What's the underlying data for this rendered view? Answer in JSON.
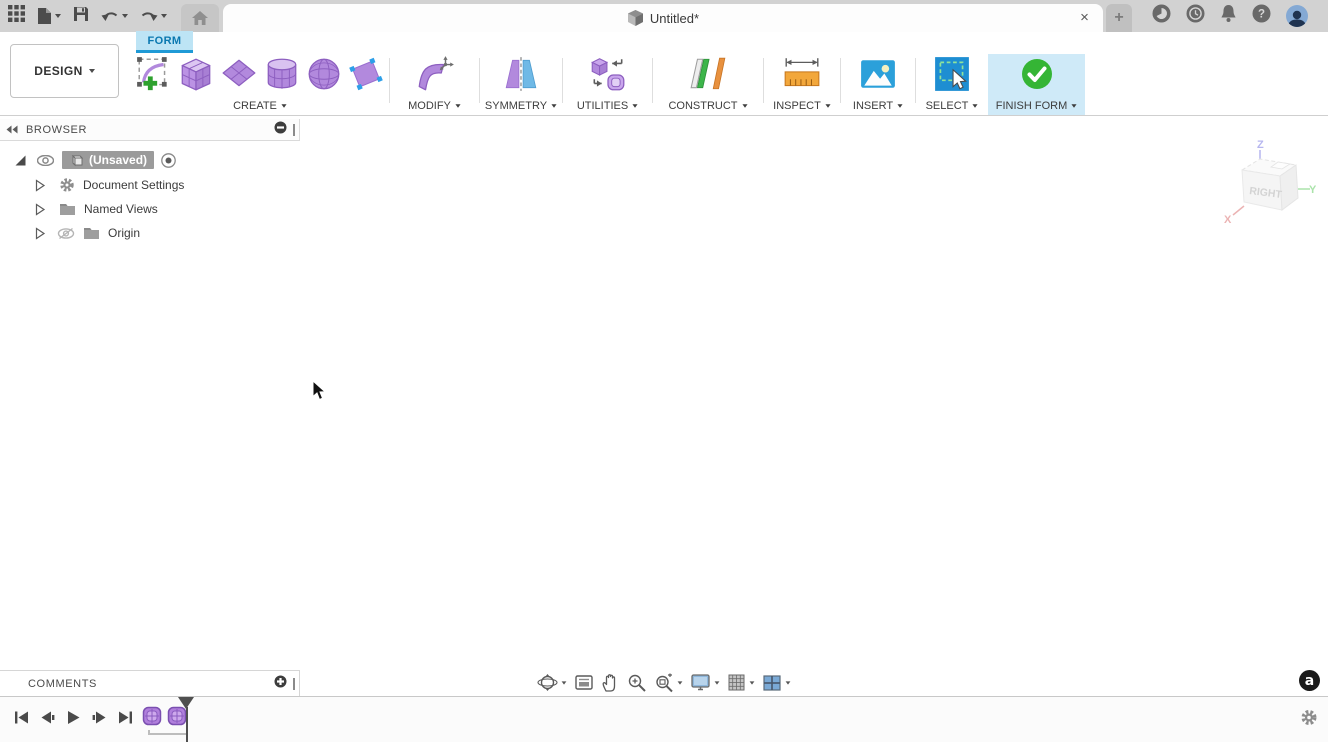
{
  "titlebar": {
    "left_icons": [
      "app-grid",
      "file",
      "save",
      "undo",
      "redo"
    ],
    "home_tab_icon": "home",
    "document_tab": {
      "title": "Untitled*",
      "close_glyph": "×",
      "icon": "model-cube"
    },
    "new_tab_glyph": "+",
    "right_icons": [
      "extensions",
      "job-status-clock",
      "notifications-bell",
      "help",
      "profile-avatar"
    ],
    "help_glyph": "?"
  },
  "toolbar": {
    "workspace": {
      "label": "DESIGN"
    },
    "context_tab": {
      "label": "FORM"
    },
    "sections": [
      {
        "label": "CREATE",
        "icons": [
          "create-form",
          "box-primitive",
          "plane-primitive",
          "cylinder-primitive",
          "sphere-primitive",
          "face-primitive"
        ]
      },
      {
        "label": "MODIFY",
        "icons": [
          "edit-form"
        ]
      },
      {
        "label": "SYMMETRY",
        "icons": [
          "mirror-symmetry"
        ]
      },
      {
        "label": "UTILITIES",
        "icons": [
          "convert-utility"
        ]
      },
      {
        "label": "CONSTRUCT",
        "icons": [
          "construction-plane"
        ]
      },
      {
        "label": "INSPECT",
        "icons": [
          "measure"
        ]
      },
      {
        "label": "INSERT",
        "icons": [
          "insert-image"
        ]
      },
      {
        "label": "SELECT",
        "icons": [
          "select-window"
        ]
      },
      {
        "label": "FINISH FORM",
        "icons": [
          "finish-form-check"
        ],
        "highlighted": true
      }
    ]
  },
  "browser": {
    "title": "BROWSER",
    "header_icons": [
      "collapse-panel",
      "display-mode",
      "resize-handle"
    ],
    "root": {
      "label": "(Unsaved)",
      "icons": [
        "expanded-arrow",
        "visibility-eye",
        "document-cube",
        "activate-radio"
      ]
    },
    "items": [
      {
        "label": "Document Settings",
        "icon": "gear"
      },
      {
        "label": "Named Views",
        "icon": "folder"
      },
      {
        "label": "Origin",
        "icon": "folder",
        "extra_icon": "visibility-off-eye"
      }
    ]
  },
  "viewcube": {
    "face": "RIGHT",
    "axis_z": "Z",
    "axis_y": "Y",
    "axis_x": "X"
  },
  "comments": {
    "title": "COMMENTS",
    "icons": [
      "add-comment",
      "resize-handle"
    ]
  },
  "navbar": {
    "icons": [
      "orbit",
      "look-at",
      "pan",
      "zoom",
      "fit",
      "display-settings",
      "grid-display",
      "viewports"
    ]
  },
  "timeline": {
    "controls": [
      "go-to-start",
      "step-back",
      "play",
      "step-forward",
      "go-to-end"
    ],
    "features": [
      "form-feature",
      "form-feature"
    ],
    "icons": [
      "position-marker",
      "settings-gear"
    ]
  },
  "badge": {
    "label": "a"
  },
  "colors": {
    "accent_blue": "#0696d7",
    "tab_highlight": "#bde4f5",
    "finish_highlight": "#cfeaf8",
    "primitive_purple": "#b289dd",
    "finish_green": "#35b535",
    "construct_green": "#3cb54a",
    "construct_orange": "#e8913f",
    "titlebar_gray": "#d2d2d2"
  }
}
